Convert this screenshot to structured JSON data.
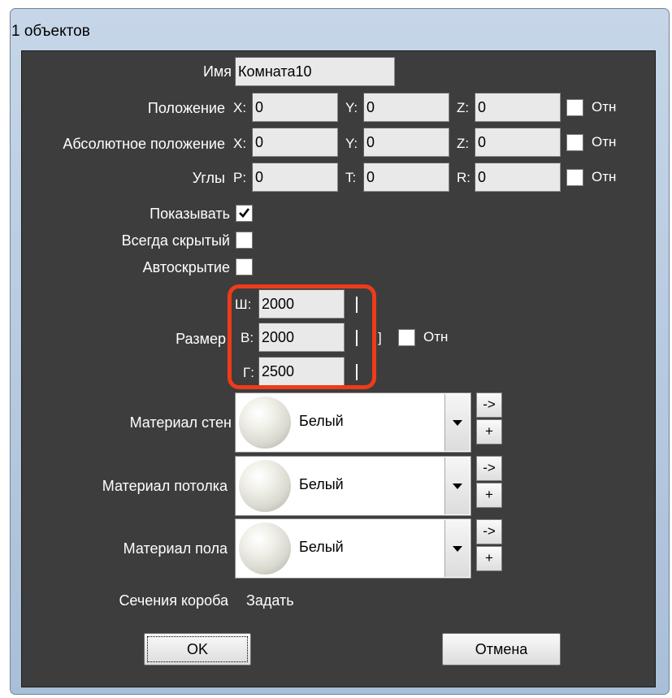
{
  "window": {
    "title": "1 объектов"
  },
  "fields": {
    "name": {
      "label": "Имя",
      "value": "Комната10"
    },
    "position": {
      "label": "Положение",
      "x_label": "X:",
      "y_label": "Y:",
      "z_label": "Z:",
      "x": "0",
      "y": "0",
      "z": "0",
      "rel_label": "Отн",
      "rel_checked": false
    },
    "abs_position": {
      "label": "Абсолютное положение",
      "x_label": "X:",
      "y_label": "Y:",
      "z_label": "Z:",
      "x": "0",
      "y": "0",
      "z": "0",
      "rel_label": "Отн",
      "rel_checked": false
    },
    "angles": {
      "label": "Углы",
      "p_label": "P:",
      "t_label": "T:",
      "r_label": "R:",
      "p": "0",
      "t": "0",
      "r": "0",
      "rel_label": "Отн",
      "rel_checked": false
    }
  },
  "checks": {
    "show": {
      "label": "Показывать",
      "checked": true
    },
    "always_hidden": {
      "label": "Всегда скрытый",
      "checked": false
    },
    "autohide": {
      "label": "Автоскрытие",
      "checked": false
    }
  },
  "size": {
    "label": "Размер",
    "w_label": "Ш:",
    "w": "2000",
    "h_label": "В:",
    "h": "2000",
    "d_label": "Г:",
    "d": "2500",
    "bracket": "]",
    "rel_label": "Отн",
    "rel_checked": false
  },
  "materials": [
    {
      "label": "Материал стен",
      "value": "Белый",
      "apply": "->",
      "add": "+"
    },
    {
      "label": "Материал потолка",
      "value": "Белый",
      "apply": "->",
      "add": "+"
    },
    {
      "label": "Материал пола",
      "value": "Белый",
      "apply": "->",
      "add": "+"
    }
  ],
  "sections": {
    "label": "Сечения короба",
    "action": "Задать"
  },
  "buttons": {
    "ok": "OK",
    "cancel": "Отмена"
  },
  "colors": {
    "highlight": "#ee3b1a",
    "client_bg": "#3d3d3d"
  }
}
